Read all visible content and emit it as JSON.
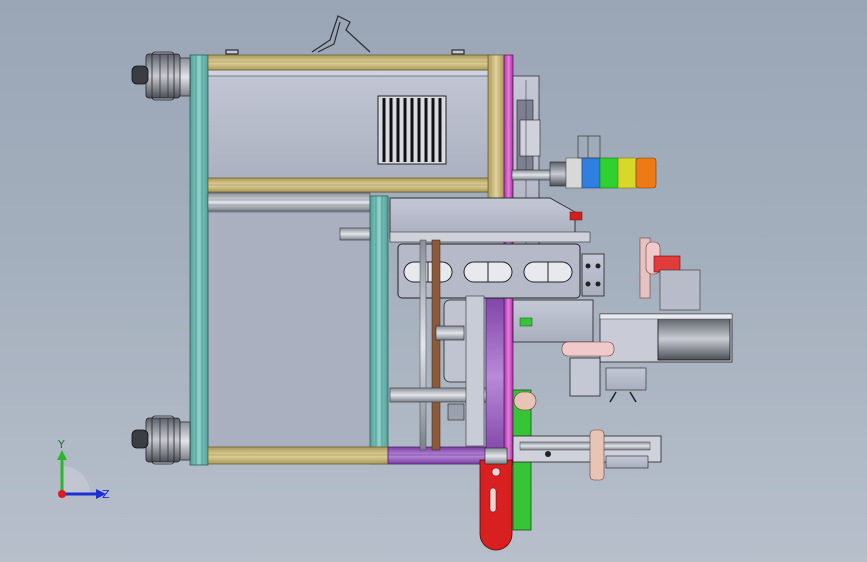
{
  "viewport": {
    "background_top": "#9aa6b6",
    "background_bottom": "#b7bfcb"
  },
  "triad": {
    "y_label": "Y",
    "z_label": "Z",
    "y_color": "#2db52d",
    "z_color": "#1c2fd6",
    "origin_color": "#e01b1b"
  },
  "colors": {
    "frame_teal": "#6fb9b3",
    "frame_tan": "#c9b878",
    "frame_purple": "#9b5fc0",
    "frame_magenta": "#d64fc8",
    "body_gray": "#b8bccb",
    "arm_red": "#d82020",
    "arm_green": "#37c437",
    "lamp_segments": [
      "#d8d8d8",
      "#2f7fe0",
      "#2ed12e",
      "#d7d82a",
      "#ee7a16"
    ]
  }
}
